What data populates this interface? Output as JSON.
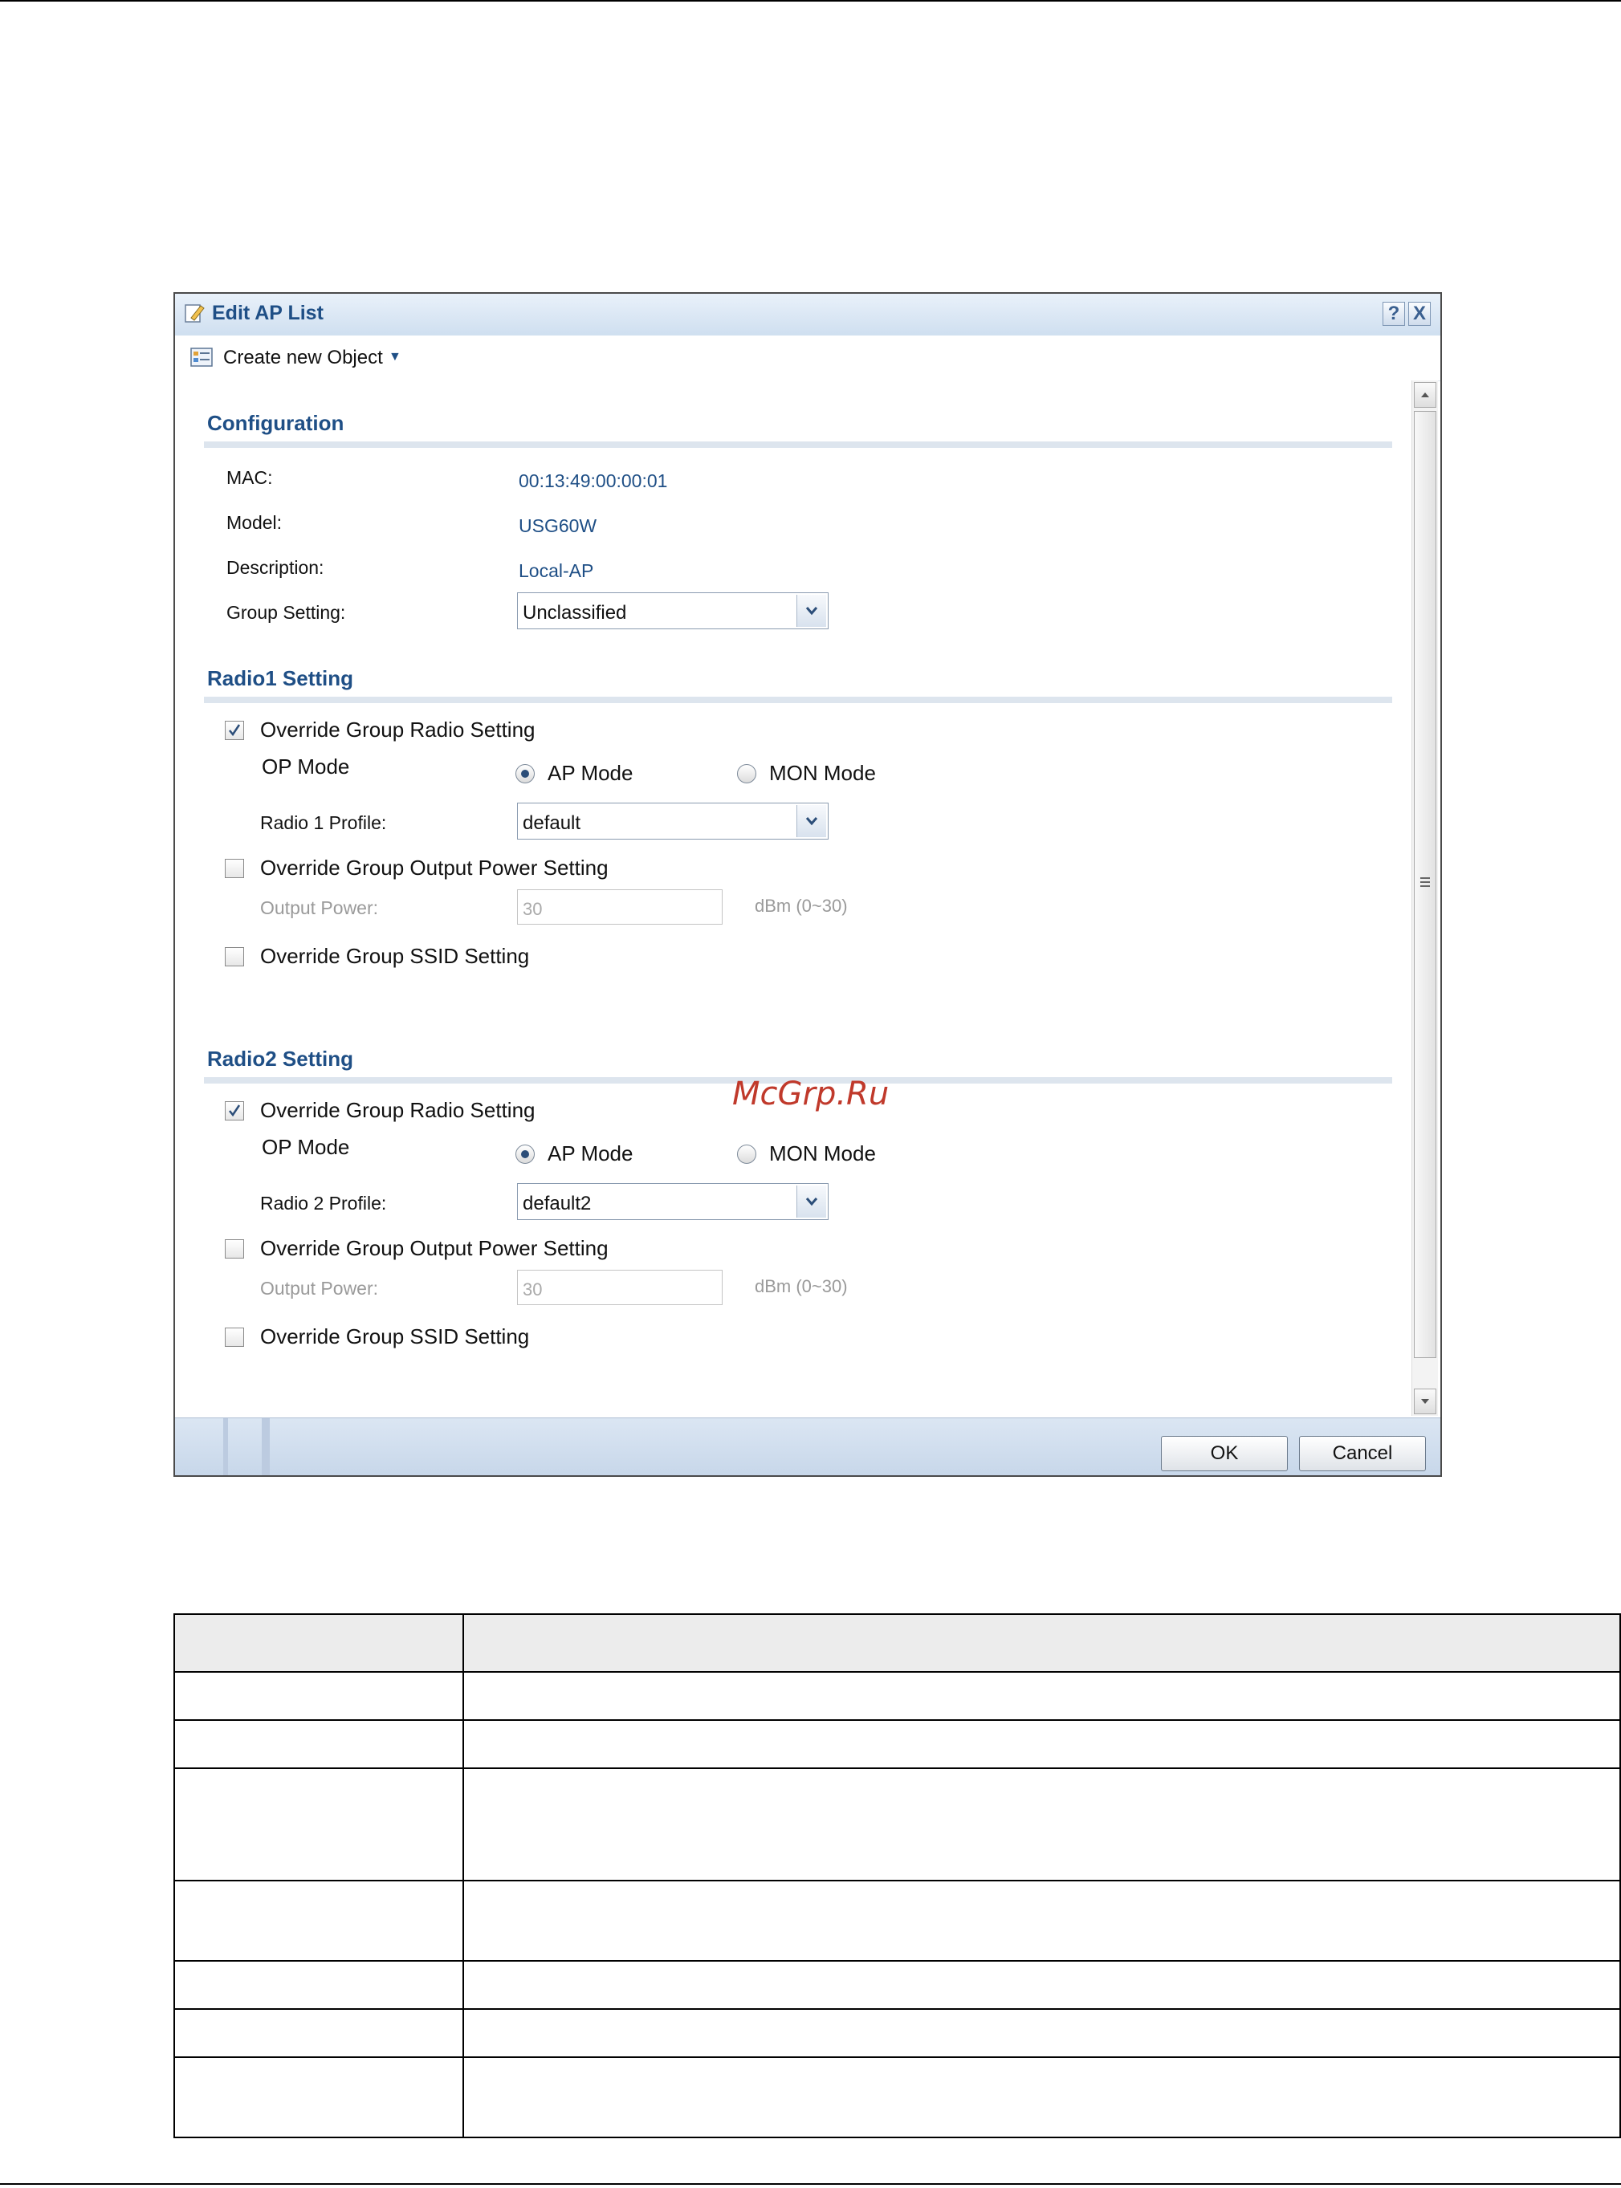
{
  "dialog": {
    "title": "Edit AP List",
    "help_label": "?",
    "close_label": "X",
    "toolbar": {
      "create_object_label": "Create new Object"
    },
    "configuration": {
      "section_title": "Configuration",
      "mac_label": "MAC:",
      "mac_value": "00:13:49:00:00:01",
      "model_label": "Model:",
      "model_value": "USG60W",
      "description_label": "Description:",
      "description_value": "Local-AP",
      "group_setting_label": "Group Setting:",
      "group_setting_value": "Unclassified"
    },
    "radio1": {
      "section_title": "Radio1 Setting",
      "override_radio_label": "Override Group Radio Setting",
      "override_radio_checked": true,
      "op_mode_label": "OP Mode",
      "ap_mode_label": "AP Mode",
      "mon_mode_label": "MON Mode",
      "op_mode_selected": "AP Mode",
      "profile_label": "Radio 1 Profile:",
      "profile_value": "default",
      "override_power_label": "Override Group Output Power Setting",
      "override_power_checked": false,
      "output_power_label": "Output Power:",
      "output_power_value": "30",
      "output_power_unit": "dBm (0~30)",
      "override_ssid_label": "Override Group SSID Setting",
      "override_ssid_checked": false
    },
    "radio2": {
      "section_title": "Radio2 Setting",
      "override_radio_label": "Override Group Radio Setting",
      "override_radio_checked": true,
      "op_mode_label": "OP Mode",
      "ap_mode_label": "AP Mode",
      "mon_mode_label": "MON Mode",
      "op_mode_selected": "AP Mode",
      "profile_label": "Radio 2 Profile:",
      "profile_value": "default2",
      "override_power_label": "Override Group Output Power Setting",
      "override_power_checked": false,
      "output_power_label": "Output Power:",
      "output_power_value": "30",
      "output_power_unit": "dBm (0~30)",
      "override_ssid_label": "Override Group SSID Setting",
      "override_ssid_checked": false
    },
    "buttons": {
      "ok_label": "OK",
      "cancel_label": "Cancel"
    }
  },
  "watermark": "McGrp.Ru",
  "table": {
    "rows": 7
  }
}
